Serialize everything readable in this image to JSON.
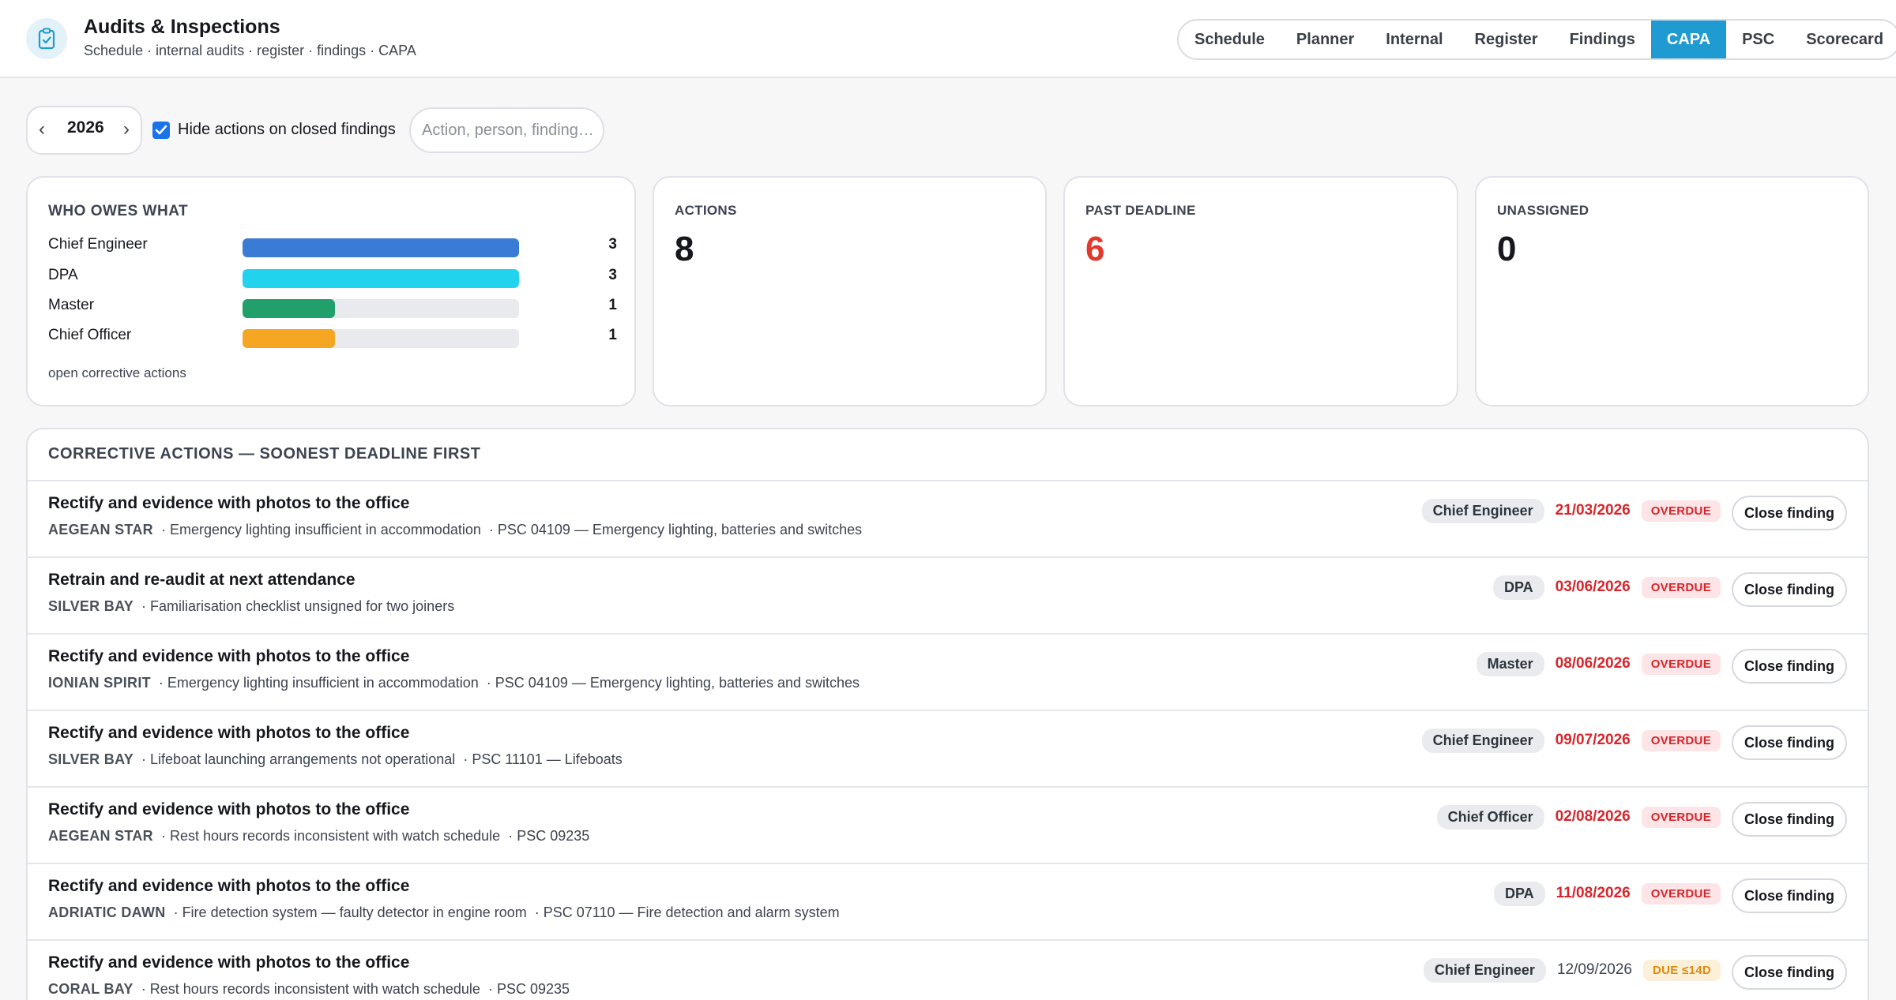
{
  "header": {
    "title": "Audits & Inspections",
    "subtitle": "Schedule · internal audits · register · findings · CAPA",
    "icon": "clipboard-check-icon",
    "tabs": [
      {
        "label": "Schedule",
        "active": false
      },
      {
        "label": "Planner",
        "active": false
      },
      {
        "label": "Internal",
        "active": false
      },
      {
        "label": "Register",
        "active": false
      },
      {
        "label": "Findings",
        "active": false
      },
      {
        "label": "CAPA",
        "active": true
      },
      {
        "label": "PSC",
        "active": false
      },
      {
        "label": "Scorecard",
        "active": false
      }
    ]
  },
  "controls": {
    "year": "2026",
    "prev": "‹",
    "next": "›",
    "hide_closed_label": "Hide actions on closed findings",
    "hide_closed_checked": true,
    "search_placeholder": "Action, person, finding…"
  },
  "owes": {
    "title": "WHO OWES WHAT",
    "footer": "open corrective actions",
    "max": 3,
    "items": [
      {
        "name": "Chief Engineer",
        "count": 3,
        "color": "#3a7bd5"
      },
      {
        "name": "DPA",
        "count": 3,
        "color": "#22d3ee"
      },
      {
        "name": "Master",
        "count": 1,
        "color": "#22a06b"
      },
      {
        "name": "Chief Officer",
        "count": 1,
        "color": "#f5a623"
      }
    ]
  },
  "stats": {
    "actions": {
      "label": "ACTIONS",
      "value": "8"
    },
    "past_deadline": {
      "label": "PAST DEADLINE",
      "value": "6"
    },
    "unassigned": {
      "label": "UNASSIGNED",
      "value": "0"
    }
  },
  "actions": {
    "title": "CORRECTIVE ACTIONS — SOONEST DEADLINE FIRST",
    "button_label": "Close finding",
    "rows": [
      {
        "title": "Rectify and evidence with photos to the office",
        "vessel": "AEGEAN STAR",
        "finding": "Emergency lighting insufficient in accommodation",
        "psc": "PSC 04109 — Emergency lighting, batteries and switches",
        "owner": "Chief Engineer",
        "due": "21/03/2026",
        "status": "OVERDUE"
      },
      {
        "title": "Retrain and re-audit at next attendance",
        "vessel": "SILVER BAY",
        "finding": "Familiarisation checklist unsigned for two joiners",
        "psc": "",
        "owner": "DPA",
        "due": "03/06/2026",
        "status": "OVERDUE"
      },
      {
        "title": "Rectify and evidence with photos to the office",
        "vessel": "IONIAN SPIRIT",
        "finding": "Emergency lighting insufficient in accommodation",
        "psc": "PSC 04109 — Emergency lighting, batteries and switches",
        "owner": "Master",
        "due": "08/06/2026",
        "status": "OVERDUE"
      },
      {
        "title": "Rectify and evidence with photos to the office",
        "vessel": "SILVER BAY",
        "finding": "Lifeboat launching arrangements not operational",
        "psc": "PSC 11101 — Lifeboats",
        "owner": "Chief Engineer",
        "due": "09/07/2026",
        "status": "OVERDUE"
      },
      {
        "title": "Rectify and evidence with photos to the office",
        "vessel": "AEGEAN STAR",
        "finding": "Rest hours records inconsistent with watch schedule",
        "psc": "PSC 09235",
        "owner": "Chief Officer",
        "due": "02/08/2026",
        "status": "OVERDUE"
      },
      {
        "title": "Rectify and evidence with photos to the office",
        "vessel": "ADRIATIC DAWN",
        "finding": "Fire detection system — faulty detector in engine room",
        "psc": "PSC 07110 — Fire detection and alarm system",
        "owner": "DPA",
        "due": "11/08/2026",
        "status": "OVERDUE"
      },
      {
        "title": "Rectify and evidence with photos to the office",
        "vessel": "CORAL BAY",
        "finding": "Rest hours records inconsistent with watch schedule",
        "psc": "PSC 09235",
        "owner": "Chief Engineer",
        "due": "12/09/2026",
        "status": "DUE ≤14D"
      }
    ]
  }
}
